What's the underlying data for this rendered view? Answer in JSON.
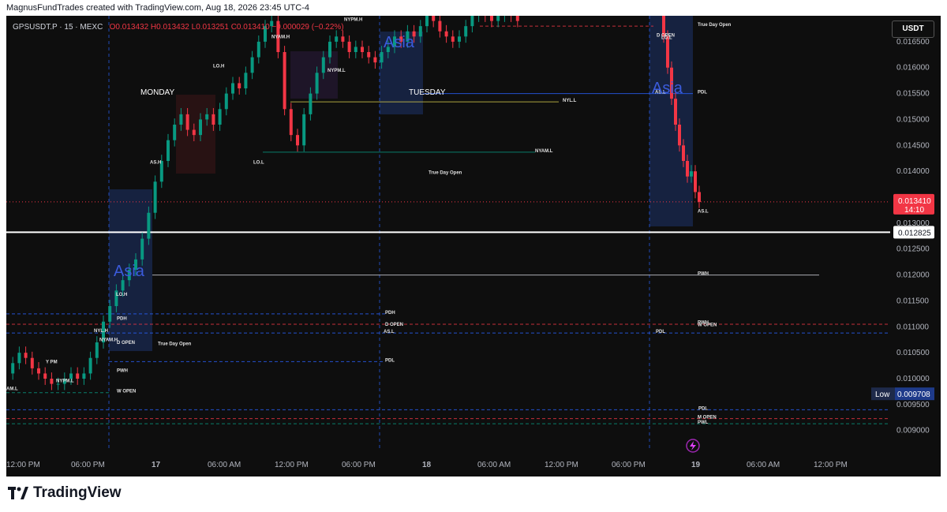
{
  "credit": "MagnusFundTrades created with TradingView.com, Aug 18, 2026 23:45 UTC-4",
  "legend": {
    "symbol": "GPSUSDT.P · 15 · MEXC",
    "o": "O0.013432",
    "h": "H0.013432",
    "l": "L0.013251",
    "c": "C0.013410",
    "change": "−0.000029 (−0.22%)"
  },
  "currency_button": "USDT",
  "brand": "TradingView",
  "colors": {
    "up": "#089981",
    "down": "#f23645",
    "bg": "#0e0e0e",
    "asia": "#2962ff",
    "price_badge": "#f23645"
  },
  "badges": {
    "last_price": "0.013410",
    "countdown": "14:10",
    "marked_price": "0.012825",
    "low_label": "Low",
    "low_value": "0.009708"
  },
  "chart_data": {
    "type": "candlestick",
    "y_ticks": [
      "0.016500",
      "0.016000",
      "0.015500",
      "0.015000",
      "0.014500",
      "0.014000",
      "0.013500",
      "0.013000",
      "0.012500",
      "0.012000",
      "0.011500",
      "0.011000",
      "0.010500",
      "0.010000",
      "0.009500",
      "0.009000"
    ],
    "y_range": [
      0.0086,
      0.017
    ],
    "x_ticks": [
      "12:00 PM",
      "06:00 PM",
      "17",
      "06:00 AM",
      "12:00 PM",
      "06:00 PM",
      "18",
      "06:00 AM",
      "12:00 PM",
      "06:00 PM",
      "19",
      "06:00 AM",
      "12:00 PM"
    ],
    "day_labels": [
      "MONDAY",
      "TUESDAY"
    ],
    "session_labels": [
      "Asia",
      "Asia",
      "Asia"
    ],
    "horizontal_level": 0.012825,
    "path": [
      0.0101,
      0.0103,
      0.0105,
      0.0104,
      0.0102,
      0.0101,
      0.01,
      0.0099,
      0.0099,
      0.01,
      0.0101,
      0.01,
      0.0101,
      0.0104,
      0.0107,
      0.0111,
      0.0114,
      0.0117,
      0.0119,
      0.0121,
      0.0123,
      0.0127,
      0.0132,
      0.0138,
      0.0142,
      0.0146,
      0.0149,
      0.0151,
      0.0148,
      0.0147,
      0.015,
      0.0151,
      0.0149,
      0.0152,
      0.0155,
      0.0157,
      0.0156,
      0.0159,
      0.0162,
      0.0165,
      0.0168,
      0.0169,
      0.0163,
      0.0152,
      0.0147,
      0.0145,
      0.0151,
      0.0155,
      0.0159,
      0.0162,
      0.0165,
      0.0166,
      0.0165,
      0.0163,
      0.0164,
      0.0163,
      0.0162,
      0.0161,
      0.0163,
      0.0164,
      0.0166,
      0.0165,
      0.0167,
      0.0166,
      0.0168,
      0.017,
      0.0169,
      0.0167,
      0.0166,
      0.0165,
      0.0166,
      0.0168,
      0.017,
      0.0171,
      0.017,
      0.0169,
      0.017,
      0.0171,
      0.017,
      0.0169
    ],
    "crash_path": [
      0.017,
      0.0166,
      0.016,
      0.0154,
      0.0149,
      0.0145,
      0.0142,
      0.0139,
      0.014,
      0.0136,
      0.01341
    ]
  },
  "annotations": [
    {
      "text": "NYL.H",
      "price": 0.0171
    },
    {
      "text": "NYPM.H",
      "price": 0.0169
    },
    {
      "text": "NYAM.H",
      "price": 0.01657
    },
    {
      "text": "LO.H",
      "price": 0.016
    },
    {
      "text": "NYPM.L",
      "price": 0.01592
    },
    {
      "text": "NYL.L",
      "price": 0.01534
    },
    {
      "text": "NYAM.L",
      "price": 0.01437
    },
    {
      "text": "LO.L",
      "price": 0.01415
    },
    {
      "text": "AS.H",
      "price": 0.01415
    },
    {
      "text": "True Day Open",
      "price": 0.01395
    },
    {
      "text": "True Day Open",
      "price": 0.0168
    },
    {
      "text": "D OPEN",
      "price": 0.0166
    },
    {
      "text": "LO.L",
      "price": 0.01655
    },
    {
      "text": "AS.L",
      "price": 0.0155
    },
    {
      "text": "PDL",
      "price": 0.0155
    },
    {
      "text": "AS.L",
      "price": 0.0132
    },
    {
      "text": "PWH",
      "price": 0.012
    },
    {
      "text": "LO.H",
      "price": 0.0116
    },
    {
      "text": "PDH",
      "price": 0.01125
    },
    {
      "text": "PDH",
      "price": 0.01113
    },
    {
      "text": "NYL.H",
      "price": 0.0109
    },
    {
      "text": "NYAM.H",
      "price": 0.01072
    },
    {
      "text": "D OPEN",
      "price": 0.01067
    },
    {
      "text": "True Day Open",
      "price": 0.01065
    },
    {
      "text": "D OPEN",
      "price": 0.01102
    },
    {
      "text": "AS.L",
      "price": 0.01088
    },
    {
      "text": "PDL",
      "price": 0.01088
    },
    {
      "text": "PWH",
      "price": 0.01106
    },
    {
      "text": "W OPEN",
      "price": 0.01101
    },
    {
      "text": "PDL",
      "price": 0.01033
    },
    {
      "text": "PWH",
      "price": 0.01013
    },
    {
      "text": "NYPM.L",
      "price": 0.00993
    },
    {
      "text": "AM.L",
      "price": 0.00978
    },
    {
      "text": "W OPEN",
      "price": 0.00973
    },
    {
      "text": "PDL",
      "price": 0.0094
    },
    {
      "text": "M OPEN",
      "price": 0.00923
    },
    {
      "text": "PWL",
      "price": 0.00913
    },
    {
      "text": "Y PM",
      "price": 0.0103
    }
  ]
}
